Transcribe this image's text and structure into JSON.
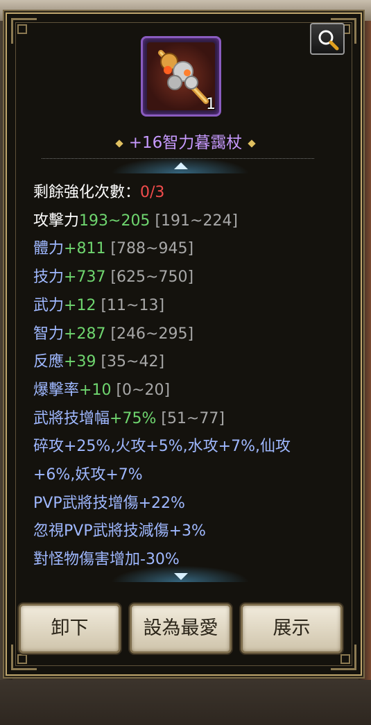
{
  "item": {
    "name": "+16智力暮靄杖",
    "count": "1",
    "icon": "staff-icon",
    "rarity_color": "#8a5cc0"
  },
  "stats": {
    "enhance_label": "剩餘強化次數：",
    "enhance_value": "0/3",
    "attack_label": "攻擊力",
    "attack_value": "193~205",
    "attack_range": "[191~224]",
    "rows": [
      {
        "label": "體力",
        "value": "+811",
        "range": "[788~945]"
      },
      {
        "label": "技力",
        "value": "+737",
        "range": "[625~750]"
      },
      {
        "label": "武力",
        "value": "+12",
        "range": "[11~13]"
      },
      {
        "label": "智力",
        "value": "+287",
        "range": "[246~295]"
      },
      {
        "label": "反應",
        "value": "+39",
        "range": "[35~42]"
      },
      {
        "label": "爆擊率",
        "value": "+10",
        "range": "[0~20]"
      },
      {
        "label": "武將技增幅",
        "value": "+75%",
        "range": "[51~77]"
      }
    ],
    "extra_lines": [
      "碎攻+25%,火攻+5%,水攻+7%,仙攻",
      "+6%,妖攻+7%",
      "PVP武將技增傷+22%",
      "忽視PVP武將技減傷+3%",
      "對怪物傷害增加-30%"
    ]
  },
  "buttons": {
    "unequip": "卸下",
    "favorite": "設為最愛",
    "show": "展示"
  },
  "icons": {
    "zoom": "magnifier-icon",
    "scroll_up": "arrow-up-icon",
    "scroll_down": "arrow-down-icon"
  },
  "colors": {
    "title": "#c79aff",
    "bonus": "#6fd66f",
    "warning": "#f24c4c",
    "attribute": "#9fb8ff"
  }
}
